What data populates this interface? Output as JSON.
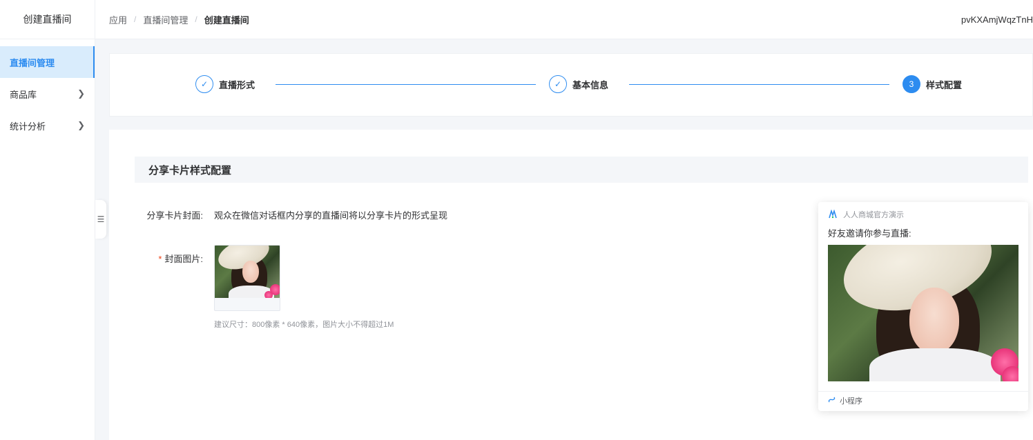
{
  "sidebar": {
    "header": "创建直播间",
    "items": [
      {
        "label": "直播间管理",
        "active": true,
        "expandable": false
      },
      {
        "label": "商品库",
        "active": false,
        "expandable": true
      },
      {
        "label": "统计分析",
        "active": false,
        "expandable": true
      }
    ],
    "collapse_icon": "menu-fold-icon"
  },
  "breadcrumb": {
    "items": [
      "应用",
      "直播间管理",
      "创建直播间"
    ],
    "separator": "/"
  },
  "user": {
    "name": "pvKXAmjWqzTnH"
  },
  "steps": [
    {
      "label": "直播形式",
      "status": "done",
      "icon": "check-icon"
    },
    {
      "label": "基本信息",
      "status": "done",
      "icon": "check-icon"
    },
    {
      "label": "样式配置",
      "status": "current",
      "number": "3"
    }
  ],
  "section": {
    "title": "分享卡片样式配置"
  },
  "form": {
    "cover_label": "分享卡片封面:",
    "cover_desc": "观众在微信对话框内分享的直播间将以分享卡片的形式呈现",
    "image_label": "封面图片:",
    "required_mark": "*",
    "hint": "建议尺寸：800像素 * 640像素，图片大小不得超过1M"
  },
  "share_card": {
    "brand": "人人商城官方演示",
    "title": "好友邀请你参与直播:",
    "footer": "小程序",
    "footer_icon": "mini-program-icon",
    "brand_icon": "brand-logo-icon"
  },
  "colors": {
    "primary": "#2d8cf0",
    "active_bg": "#d9ecfc",
    "required": "#ed4014"
  }
}
